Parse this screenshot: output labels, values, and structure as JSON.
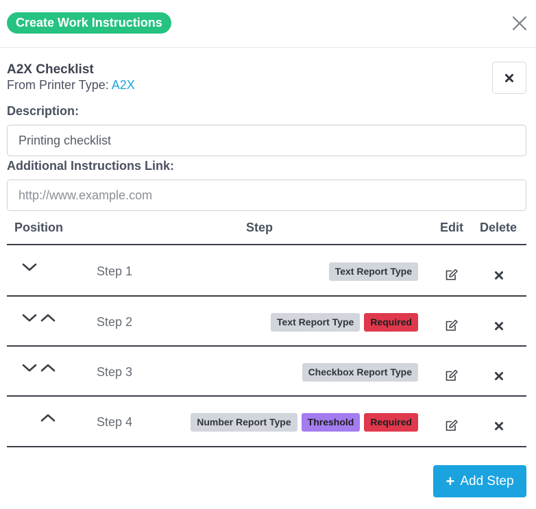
{
  "header": {
    "title": "Create Work Instructions"
  },
  "checklist": {
    "name": "A2X Checklist",
    "from_prefix": "From Printer Type:",
    "printer_type": "A2X"
  },
  "description": {
    "label": "Description:",
    "value": "Printing checklist"
  },
  "link": {
    "label": "Additional Instructions Link:",
    "placeholder": "http://www.example.com",
    "value": ""
  },
  "table": {
    "columns": {
      "position": "Position",
      "step": "Step",
      "edit": "Edit",
      "delete": "Delete"
    },
    "rows": [
      {
        "label": "Step 1",
        "badges": [
          {
            "text": "Text Report Type"
          }
        ]
      },
      {
        "label": "Step 2",
        "badges": [
          {
            "text": "Text Report Type"
          },
          {
            "text": "Required"
          }
        ]
      },
      {
        "label": "Step 3",
        "badges": [
          {
            "text": "Checkbox Report Type"
          }
        ]
      },
      {
        "label": "Step 4",
        "badges": [
          {
            "text": "Number Report Type"
          },
          {
            "text": "Threshold"
          },
          {
            "text": "Required"
          }
        ]
      }
    ]
  },
  "actions": {
    "add_step": "Add Step",
    "add_icon": "+"
  },
  "colors": {
    "title_pill": "#26c281",
    "link": "#1ba7d9",
    "required": "#e0384d",
    "threshold": "#a37cf0",
    "primary": "#1aa3df"
  },
  "icons": {
    "close": "close-icon",
    "remove": "x-icon",
    "move_down": "chevron-down-icon",
    "move_up": "chevron-up-icon",
    "edit": "edit-icon",
    "delete": "x-icon"
  }
}
